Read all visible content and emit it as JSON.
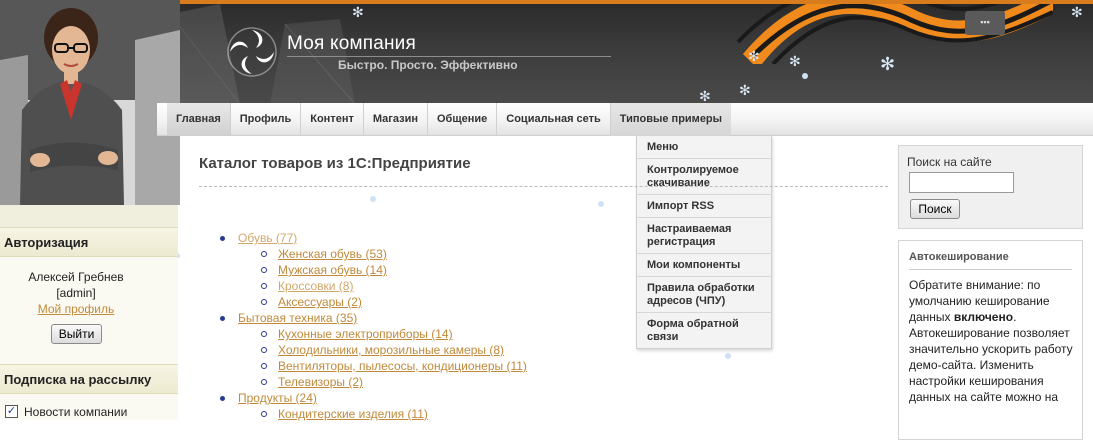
{
  "header": {
    "site_title": "Моя компания",
    "slogan": "Быстро. Просто. Эффективно",
    "corner_icon": "sitemap-icon"
  },
  "nav": {
    "items": [
      {
        "label": "Главная",
        "state": "active"
      },
      {
        "label": "Профиль"
      },
      {
        "label": "Контент"
      },
      {
        "label": "Магазин"
      },
      {
        "label": "Общение"
      },
      {
        "label": "Социальная сеть"
      },
      {
        "label": "Типовые примеры",
        "state": "open"
      }
    ],
    "dropdown": [
      {
        "label": "Меню"
      },
      {
        "label": "Контролируемое скачивание"
      },
      {
        "label": "Импорт RSS"
      },
      {
        "label": "Настраиваемая регистрация"
      },
      {
        "label": "Мои компоненты"
      },
      {
        "label": "Правила обработки адресов (ЧПУ)"
      },
      {
        "label": "Форма обратной связи"
      }
    ]
  },
  "sidebar_left": {
    "auth_title": "Авторизация",
    "user_name": "Алексей Гребнев",
    "user_login": "[admin]",
    "profile_link": "Мой профиль",
    "logout_button": "Выйти",
    "subscribe_title": "Подписка на рассылку",
    "subscribe_option": "Новости компании",
    "subscribe_checked": true
  },
  "main": {
    "title": "Каталог товаров из 1С:Предприятие",
    "catalog": [
      {
        "label": "Обувь (77)",
        "tone": "pale",
        "children": [
          {
            "label": "Женская обувь (53)",
            "tone": "orange"
          },
          {
            "label": "Мужская обувь (14)",
            "tone": "orange"
          },
          {
            "label": "Кроссовки (8)",
            "tone": "pale"
          },
          {
            "label": "Аксессуары (2)",
            "tone": "orange"
          }
        ]
      },
      {
        "label": "Бытовая техника (35)",
        "tone": "orange",
        "children": [
          {
            "label": "Кухонные электроприборы (14)",
            "tone": "orange"
          },
          {
            "label": "Холодильники, морозильные камеры (8)",
            "tone": "orange"
          },
          {
            "label": "Вентиляторы, пылесосы, кондиционеры (11)",
            "tone": "orange"
          },
          {
            "label": "Телевизоры (2)",
            "tone": "orange"
          }
        ]
      },
      {
        "label": "Продукты (24)",
        "tone": "orange",
        "children": [
          {
            "label": "Кондитерские изделия (11)",
            "tone": "orange"
          }
        ]
      }
    ]
  },
  "sidebar_right": {
    "search_label": "Поиск на сайте",
    "search_value": "",
    "search_button": "Поиск",
    "auto_title": "Автокеширование",
    "auto_text_1": "Обратите внимание: по умолчанию кеширование данных ",
    "auto_text_bold": "включено",
    "auto_text_2": ". Автокеширование позволяет значительно ускорить работу демо-сайта. Изменить настройки кеширования данных на сайте можно на"
  },
  "colors": {
    "accent": "#d97c1e",
    "link": "#c08a3a",
    "link_visited": "#d1a86b"
  }
}
